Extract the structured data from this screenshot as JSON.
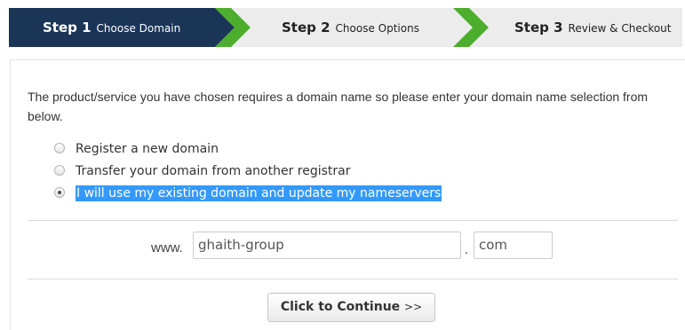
{
  "steps": [
    {
      "number": "Step 1",
      "name": "Choose Domain",
      "active": true
    },
    {
      "number": "Step 2",
      "name": "Choose Options",
      "active": false
    },
    {
      "number": "Step 3",
      "name": "Review & Checkout",
      "active": false
    }
  ],
  "colors": {
    "active_step": "#1b3557",
    "inactive_step": "#ececec",
    "chevron": "#4cae2c",
    "selection_highlight": "#3399ff"
  },
  "intro_text": "The product/service you have chosen requires a domain name so please enter your domain name selection from below.",
  "domain_options": [
    {
      "label": "Register a new domain",
      "selected": false
    },
    {
      "label": "Transfer your domain from another registrar",
      "selected": false
    },
    {
      "label": "I will use my existing domain and update my nameservers",
      "selected": true
    }
  ],
  "domain_form": {
    "prefix": "www.",
    "domain_value": "ghaith-group",
    "separator": ".",
    "tld_value": "com"
  },
  "continue_button": {
    "label": "Click to Continue",
    "suffix": ">>"
  }
}
